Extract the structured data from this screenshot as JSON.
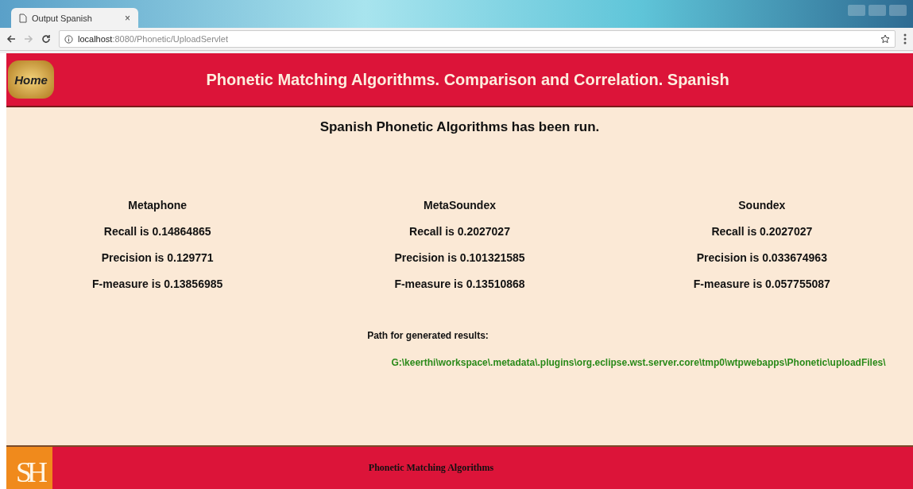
{
  "browser": {
    "tab": {
      "title": "Output Spanish",
      "close": "×"
    },
    "address": {
      "host": "localhost",
      "rest": ":8080/Phonetic/UploadServlet"
    }
  },
  "header": {
    "home_label": "Home",
    "title": "Phonetic Matching Algorithms. Comparison and Correlation. Spanish"
  },
  "message": "Spanish Phonetic Algorithms has been run.",
  "algorithms": [
    {
      "name": "Metaphone",
      "recall": "Recall is 0.14864865",
      "precision": "Precision is 0.129771",
      "f_measure": "F-measure is 0.13856985"
    },
    {
      "name": "MetaSoundex",
      "recall": "Recall is 0.2027027",
      "precision": "Precision is 0.101321585",
      "f_measure": "F-measure is 0.13510868"
    },
    {
      "name": "Soundex",
      "recall": "Recall is 0.2027027",
      "precision": "Precision is 0.033674963",
      "f_measure": "F-measure is 0.057755087"
    }
  ],
  "results": {
    "label": "Path for generated results:",
    "path": "G:\\keerthi\\workspace\\.metadata\\.plugins\\org.eclipse.wst.server.core\\tmp0\\wtpwebapps\\Phonetic\\uploadFiles\\"
  },
  "footer": {
    "logo": "SH",
    "title": "Phonetic Matching Algorithms"
  }
}
